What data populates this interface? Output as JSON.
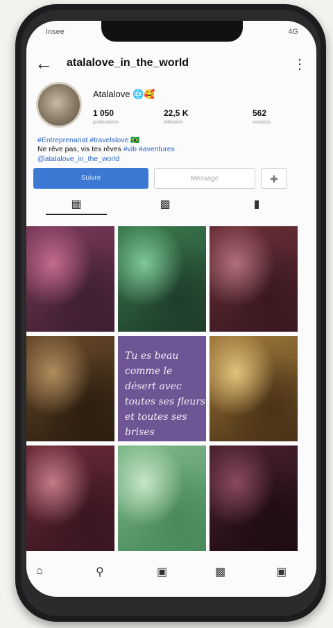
{
  "status": {
    "time": "Insee",
    "signal": "4G"
  },
  "header": {
    "username": "atalalove_in_the_world",
    "back_icon": "arrow-left-icon"
  },
  "profile": {
    "display_name": "Atalalove 🌐🥰",
    "stats": [
      {
        "value": "1 050",
        "label": "publications"
      },
      {
        "value": "22,5 K",
        "label": "followers"
      },
      {
        "value": "562",
        "label": "suivi(e)s"
      }
    ],
    "bio_line1": "#Entreprenariat #travelslove 🇧🇷",
    "bio_line2_text": "Ne rêve pas, vis tes rêves ",
    "bio_line2_tags": "#vib #aventures",
    "bio_line3": "@atalalove_in_the_world"
  },
  "actions": {
    "follow_label": "Suivre",
    "message_label": "Message",
    "add_user_icon": "person-add-icon"
  },
  "tabs": [
    {
      "name": "grid",
      "icon": "grid-icon"
    },
    {
      "name": "reels",
      "icon": "reels-icon"
    },
    {
      "name": "tagged",
      "icon": "tag-icon"
    }
  ],
  "grid": {
    "posts": [
      {
        "type": "image",
        "colors": [
          "#7a3a5a",
          "#c46a8e",
          "#3e1f31"
        ]
      },
      {
        "type": "image",
        "colors": [
          "#3a7a4e",
          "#7fc79a",
          "#1f3e2a"
        ]
      },
      {
        "type": "image",
        "colors": [
          "#6b2f38",
          "#b0707a",
          "#3a1820"
        ]
      },
      {
        "type": "image",
        "colors": [
          "#6a4a2a",
          "#b08c5e",
          "#2c1e10"
        ]
      },
      {
        "type": "quote",
        "colors": [
          "#6e5594"
        ],
        "text": "Tu es beau comme le désert avec toutes ses fleurs et toutes ses brises"
      },
      {
        "type": "image",
        "colors": [
          "#a17a3c",
          "#e3c27a",
          "#4a3216"
        ]
      },
      {
        "type": "image",
        "colors": [
          "#6a2a38",
          "#c27a86",
          "#3a1620"
        ]
      },
      {
        "type": "image",
        "colors": [
          "#7eb88a",
          "#c6e6c6",
          "#4a8a5a"
        ]
      },
      {
        "type": "image",
        "colors": [
          "#4a2030",
          "#8a4a5e",
          "#1e0c14"
        ]
      }
    ]
  },
  "bottom_nav": [
    "home-icon",
    "search-icon",
    "add-post-icon",
    "reels-icon",
    "profile-icon"
  ]
}
